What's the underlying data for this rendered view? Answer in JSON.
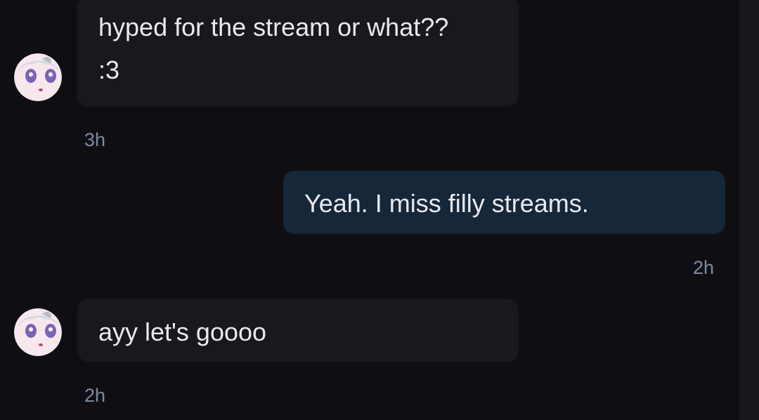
{
  "messages": [
    {
      "direction": "incoming",
      "lines": [
        "hyped for the stream or what??",
        ":3"
      ],
      "time": "3h"
    },
    {
      "direction": "outgoing",
      "lines": [
        "Yeah. I miss filly streams."
      ],
      "time": "2h"
    },
    {
      "direction": "incoming",
      "lines": [
        "ayy let's goooo"
      ],
      "time": "2h"
    }
  ],
  "colors": {
    "background": "#0f0f13",
    "incoming_bubble": "#18181d",
    "outgoing_bubble": "#16273a",
    "timestamp": "#7d8aa3"
  },
  "icons": {
    "avatar": "anime-girl-avatar-icon"
  }
}
